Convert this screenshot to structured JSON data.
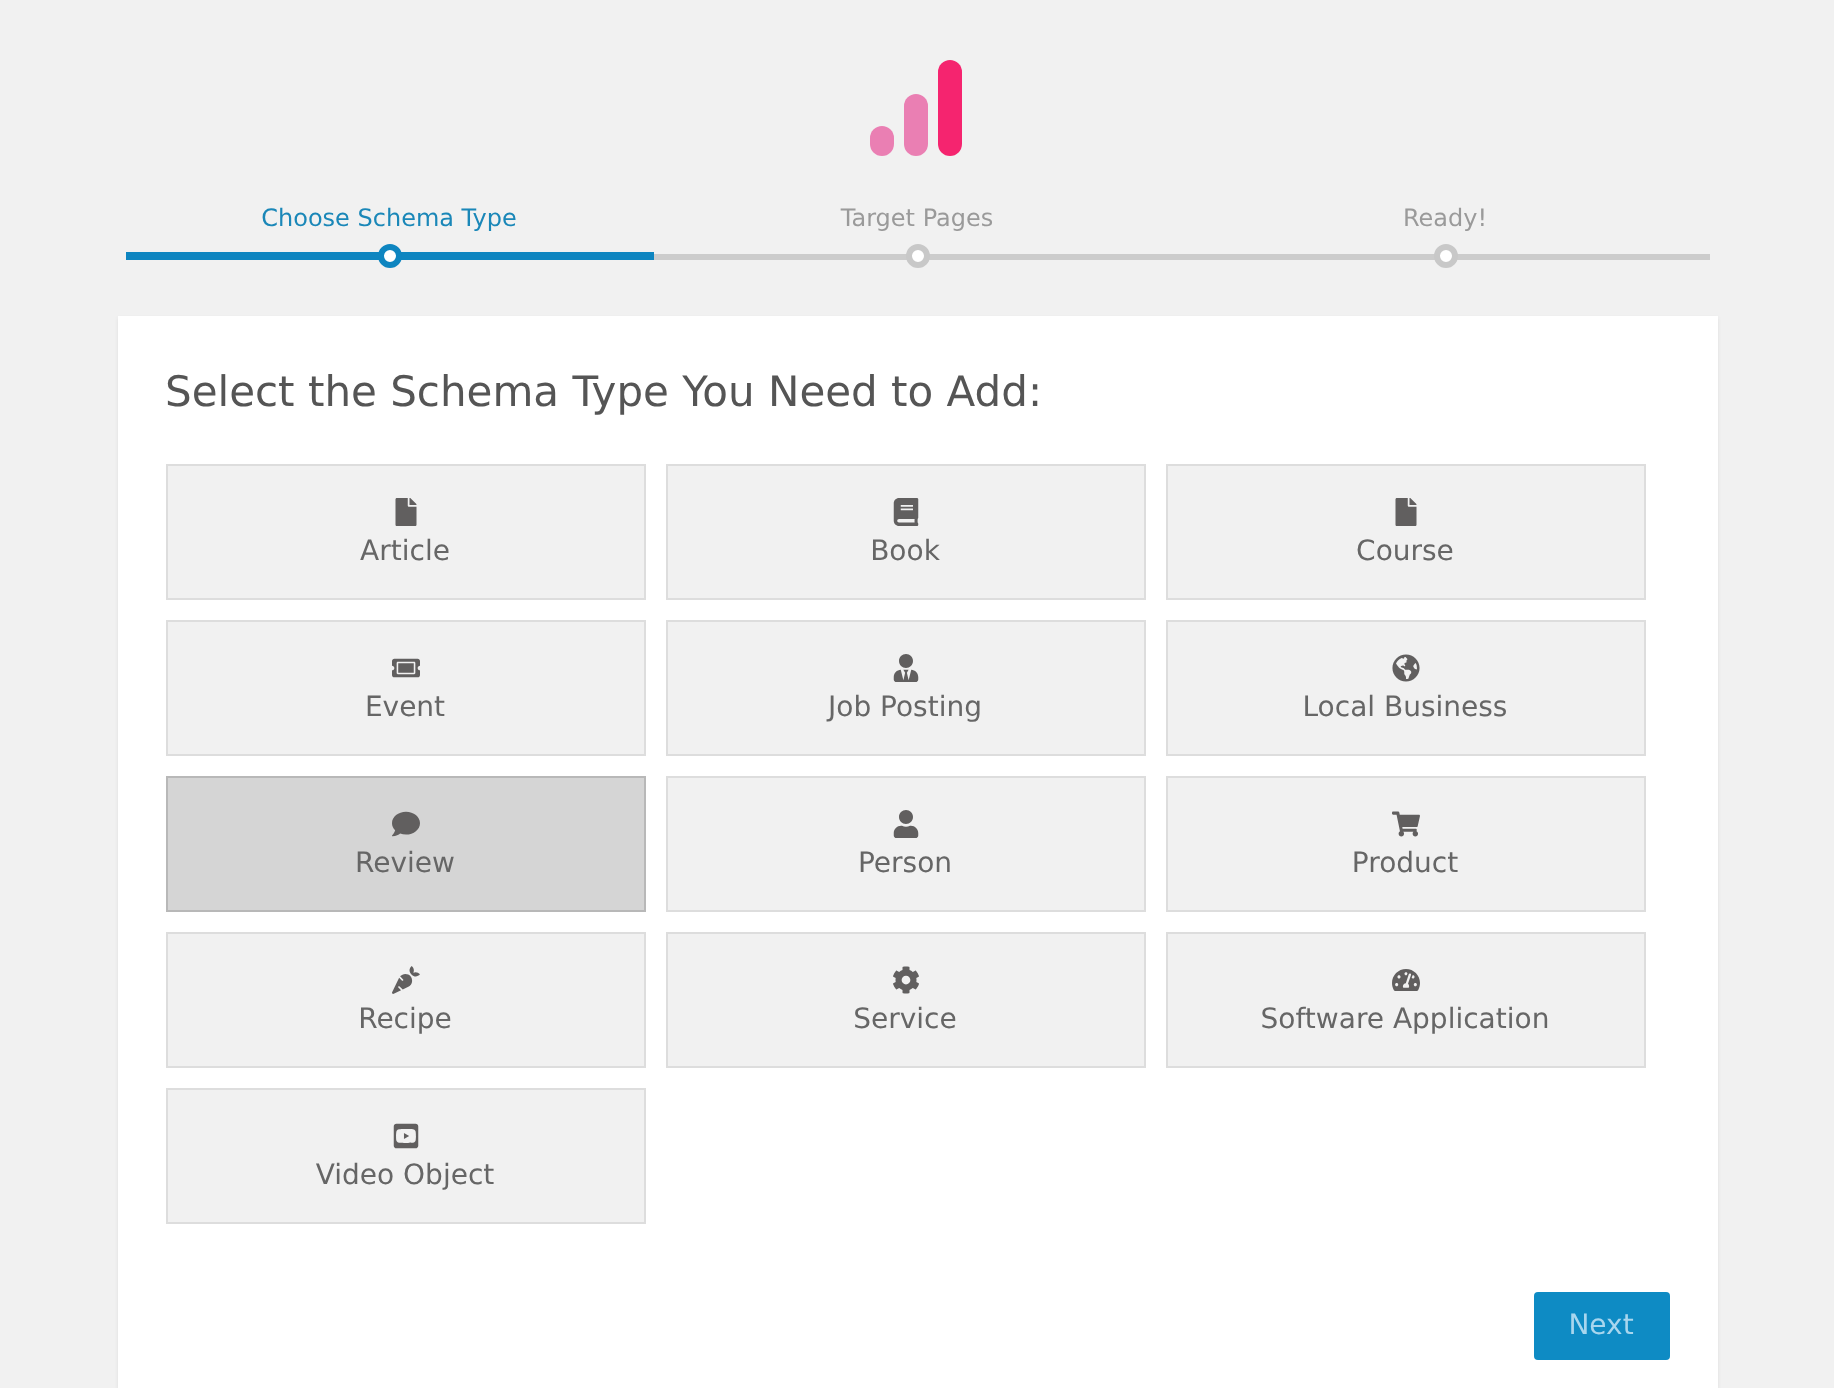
{
  "steps": [
    {
      "label": "Choose Schema Type",
      "selected": true
    },
    {
      "label": "Target Pages",
      "selected": false
    },
    {
      "label": "Ready!",
      "selected": false
    }
  ],
  "heading": "Select the Schema Type You Need to Add:",
  "schema_types": [
    {
      "label": "Article",
      "kind": "document",
      "selected": false
    },
    {
      "label": "Book",
      "kind": "book",
      "selected": false
    },
    {
      "label": "Course",
      "kind": "document",
      "selected": false
    },
    {
      "label": "Event",
      "kind": "tickets",
      "selected": false
    },
    {
      "label": "Job Posting",
      "kind": "worker",
      "selected": false
    },
    {
      "label": "Local Business",
      "kind": "globe",
      "selected": false
    },
    {
      "label": "Review",
      "kind": "comment",
      "selected": true
    },
    {
      "label": "Person",
      "kind": "person",
      "selected": false
    },
    {
      "label": "Product",
      "kind": "cart",
      "selected": false
    },
    {
      "label": "Recipe",
      "kind": "carrot",
      "selected": false
    },
    {
      "label": "Service",
      "kind": "gear",
      "selected": false
    },
    {
      "label": "Software Application",
      "kind": "gauge",
      "selected": false
    },
    {
      "label": "Video Object",
      "kind": "video",
      "selected": false
    }
  ],
  "next_button": "Next"
}
